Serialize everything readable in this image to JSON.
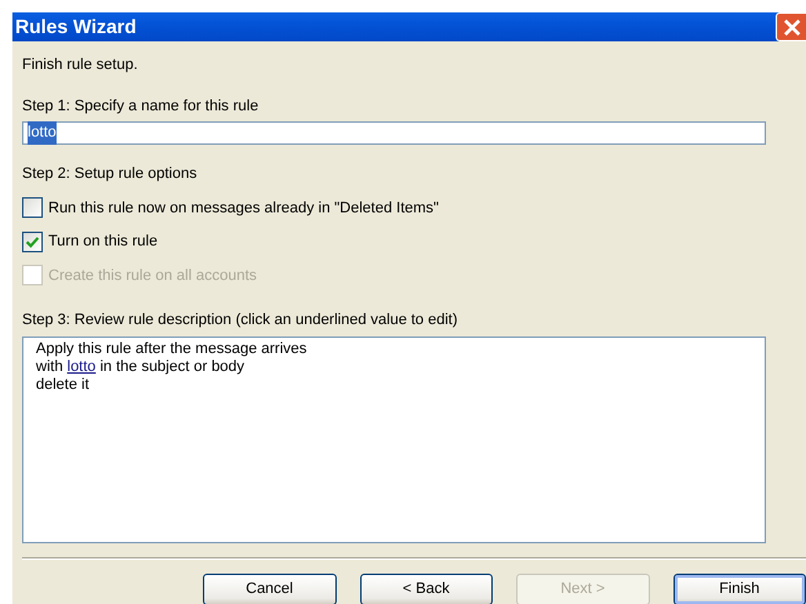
{
  "window": {
    "title": "Rules Wizard"
  },
  "heading": "Finish rule setup.",
  "step1": {
    "label": "Step 1: Specify a name for this rule",
    "value": "lotto"
  },
  "step2": {
    "label": "Step 2: Setup rule options",
    "options": [
      {
        "label": "Run this rule now on messages already in \"Deleted Items\"",
        "checked": false,
        "disabled": false
      },
      {
        "label": "Turn on this rule",
        "checked": true,
        "disabled": false
      },
      {
        "label": "Create this rule on all accounts",
        "checked": false,
        "disabled": true
      }
    ]
  },
  "step3": {
    "label": "Step 3: Review rule description (click an underlined value to edit)",
    "lines": [
      {
        "before": "Apply this rule after the message arrives"
      },
      {
        "before": "with ",
        "link": "lotto",
        "after": " in the subject or body"
      },
      {
        "before": "delete it"
      }
    ]
  },
  "buttons": [
    {
      "label": "Cancel",
      "disabled": false,
      "default": false
    },
    {
      "label": "< Back",
      "disabled": false,
      "default": false
    },
    {
      "label": "Next >",
      "disabled": true,
      "default": false
    },
    {
      "label": "Finish",
      "disabled": false,
      "default": true
    }
  ]
}
